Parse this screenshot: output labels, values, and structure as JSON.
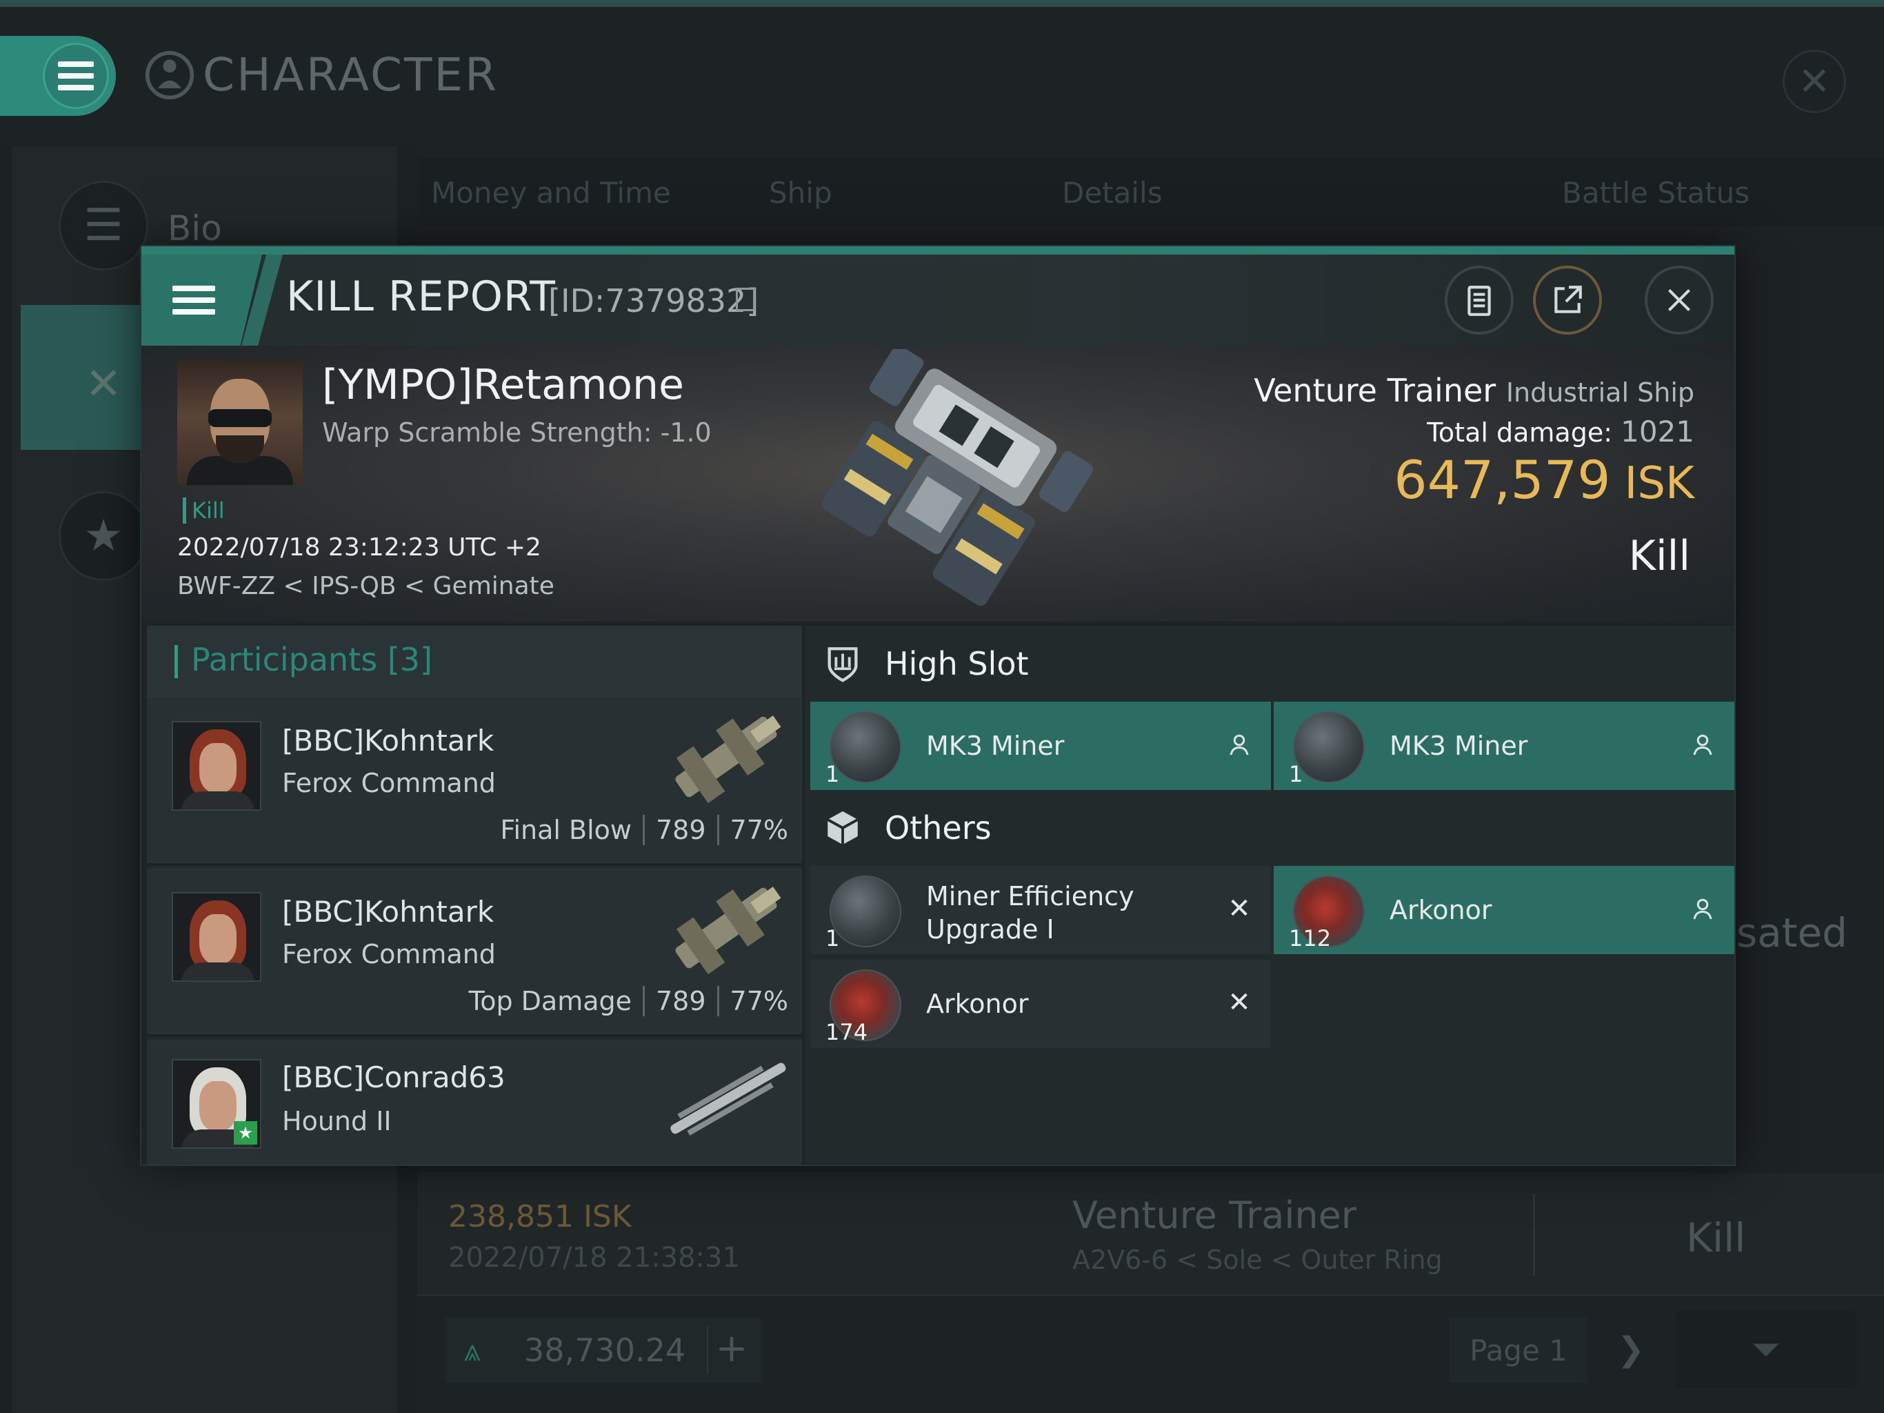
{
  "background_window": {
    "title": "CHARACTER",
    "sidebar": {
      "bio_label": "Bio"
    },
    "tabs": [
      "Money and Time",
      "Ship",
      "Details",
      "Battle Status"
    ],
    "list_row": {
      "isk": "238,851 ISK",
      "date": "2022/07/18 21:38:31",
      "ship": "Venture Trainer",
      "location": "A2V6-6 < Sole < Outer Ring",
      "type": "Kill"
    },
    "wallet_value": "38,730.24",
    "page_label": "Page 1",
    "partial_text": "sated"
  },
  "kill_report": {
    "title": "KILL REPORT",
    "id": "[ID:7379832]",
    "victim": {
      "name": "[YMPO]Retamone",
      "warp_scramble": "Warp Scramble Strength: -1.0",
      "tag": "Kill",
      "datetime": "2022/07/18 23:12:23 UTC +2",
      "location": "BWF-ZZ < IPS-QB < Geminate",
      "ship_name": "Venture Trainer",
      "ship_class": "Industrial Ship",
      "total_damage_label": "Total damage:",
      "total_damage": "1021",
      "isk_value": "647,579",
      "isk_unit": "ISK",
      "result": "Kill"
    },
    "participants": {
      "header": "Participants [3]",
      "rows": [
        {
          "name": "[BBC]Kohntark",
          "ship": "Ferox Command",
          "role": "Final Blow",
          "damage": "789",
          "percent": "77%"
        },
        {
          "name": "[BBC]Kohntark",
          "ship": "Ferox Command",
          "role": "Top Damage",
          "damage": "789",
          "percent": "77%"
        },
        {
          "name": "[BBC]Conrad63",
          "ship": "Hound II"
        }
      ]
    },
    "sections": {
      "high_slot": {
        "label": "High Slot",
        "items": [
          {
            "qty": "1",
            "name": "MK3 Miner",
            "status": "dropped"
          },
          {
            "qty": "1",
            "name": "MK3 Miner",
            "status": "dropped"
          }
        ]
      },
      "others": {
        "label": "Others",
        "items": [
          {
            "qty": "1",
            "name": "Miner Efficiency Upgrade I",
            "status": "destroyed"
          },
          {
            "qty": "112",
            "name": "Arkonor",
            "status": "dropped"
          },
          {
            "qty": "174",
            "name": "Arkonor",
            "status": "destroyed"
          }
        ]
      }
    }
  },
  "colors": {
    "accent_teal": "#2e8a7a",
    "dropped_item": "#2b6d63",
    "isk_gold": "#e8b956",
    "kill_green": "#2e9d86"
  }
}
